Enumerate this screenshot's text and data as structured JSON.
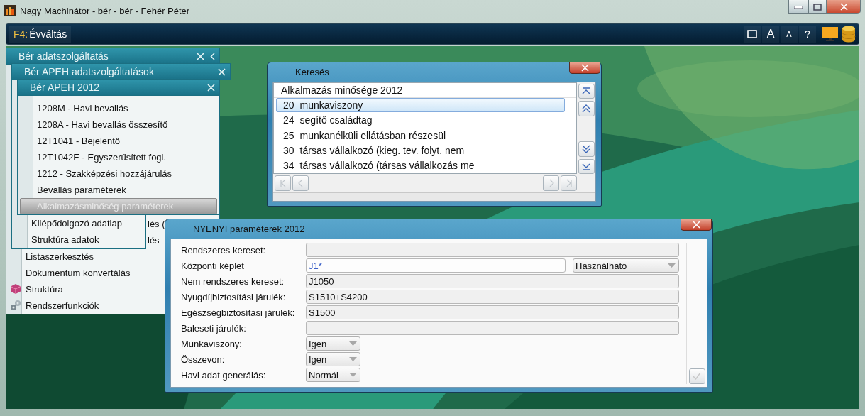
{
  "window": {
    "title": "Nagy Machinátor - bér - bér - Fehér Péter"
  },
  "toolbar": {
    "command": {
      "key": "F4:",
      "label": "Évváltás"
    },
    "buttons": [
      {
        "kind": "window"
      },
      {
        "kind": "font-large",
        "label": "A"
      },
      {
        "kind": "font-small",
        "label": "A"
      },
      {
        "kind": "help",
        "label": "?"
      }
    ]
  },
  "menus": [
    {
      "title": "Bér adatszolgáltatás",
      "collapsible": true,
      "items": [
        {
          "label": "lés (",
          "kind": "cut",
          "selected": false
        },
        {
          "label": "lés",
          "kind": "cut",
          "selected": false
        },
        {
          "label": "Listaszerkesztés",
          "kind": "plain",
          "selected": false
        },
        {
          "label": "Dokumentum konvertálás",
          "kind": "plain",
          "selected": false
        },
        {
          "label": "Struktúra",
          "kind": "cube",
          "selected": false
        },
        {
          "label": "Rendszerfunkciók",
          "kind": "gears",
          "selected": false
        }
      ]
    },
    {
      "title": "Bér APEH adatszolgáltatások",
      "collapsible": false,
      "items": [
        {
          "label": "Kilépődolgozó adatlap",
          "kind": "plain",
          "selected": false
        },
        {
          "label": "Struktúra adatok",
          "kind": "plain",
          "selected": false
        }
      ]
    },
    {
      "title": "Bér APEH 2012",
      "collapsible": false,
      "items": [
        {
          "label": "1208M - Havi bevallás",
          "kind": "plain",
          "selected": false
        },
        {
          "label": "1208A - Havi bevallás összesítő",
          "kind": "plain",
          "selected": false
        },
        {
          "label": "12T1041 - Bejelentő",
          "kind": "plain",
          "selected": false
        },
        {
          "label": "12T1042E - Egyszerűsített fogl.",
          "kind": "plain",
          "selected": false
        },
        {
          "label": "1212 - Szakképzési hozzájárulás",
          "kind": "plain",
          "selected": false
        },
        {
          "label": "Bevallás paraméterek",
          "kind": "plain",
          "selected": false
        },
        {
          "label": "Alkalmazásminőség paraméterek",
          "kind": "plain",
          "selected": true
        }
      ]
    }
  ],
  "search": {
    "title": "Keresés",
    "header": "Alkalmazás minősége 2012",
    "rows": [
      {
        "code": "20",
        "name": "munkaviszony",
        "selected": true
      },
      {
        "code": "24",
        "name": "segítő családtag",
        "selected": false
      },
      {
        "code": "25",
        "name": "munkanélküli ellátásban részesül",
        "selected": false
      },
      {
        "code": "30",
        "name": "társas vállalkozó (kieg. tev. folyt. nem",
        "selected": false
      },
      {
        "code": "34",
        "name": "társas vállalkozó (társas vállalkozás me",
        "selected": false
      }
    ]
  },
  "form": {
    "title": "NYENYI paraméterek 2012",
    "fields": [
      {
        "label": "Rendszeres kereset:",
        "kind": "text",
        "editable": false
      },
      {
        "label": "Központi képlet",
        "kind": "text",
        "editable": true,
        "value": "J1*",
        "option": "Használható"
      },
      {
        "label": "Nem rendszeres kereset:",
        "kind": "text",
        "editable": false,
        "value": "J1050"
      },
      {
        "label": "Nyugdíjbiztosítási járulék:",
        "kind": "text",
        "editable": false,
        "value": "S1510+S4200"
      },
      {
        "label": "Egészségbiztosítási járulék:",
        "kind": "text",
        "editable": false,
        "value": "S1500"
      },
      {
        "label": "Baleseti járulék:",
        "kind": "text",
        "editable": false
      },
      {
        "label": "Munkaviszony:",
        "kind": "combo",
        "editable": false,
        "value": "Igen"
      },
      {
        "label": "Összevon:",
        "kind": "combo",
        "editable": false,
        "value": "Igen"
      },
      {
        "label": "Havi adat generálás:",
        "kind": "combo",
        "editable": false,
        "value": "Normál"
      }
    ]
  }
}
